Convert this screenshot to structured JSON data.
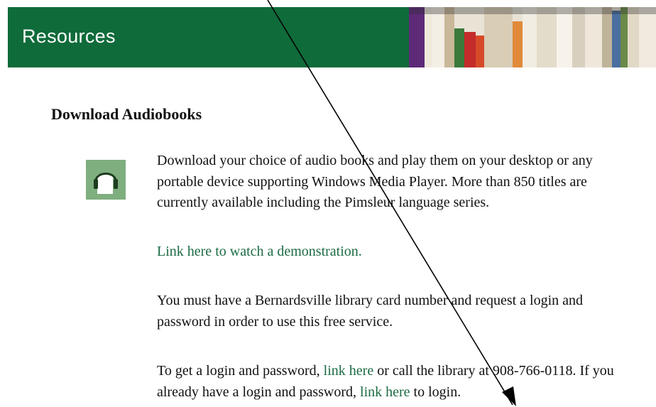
{
  "banner": {
    "title": "Resources"
  },
  "section": {
    "heading": "Download Audiobooks",
    "icon": "headphones-icon"
  },
  "paragraphs": {
    "p1": "Download your choice of audio books and play them on your desktop or any portable device supporting Windows Media Player. More than 850 titles are currently available including the Pimsleur language series.",
    "demo_link": "Link here to watch a demonstration.",
    "p3": "You must have a Bernardsville library card number and request a login and password in order to use this free service.",
    "p4_part1": "To get a login and password, ",
    "p4_link1": "link here",
    "p4_part2": " or call the library at 908-766-0118. If you already have a login and password, ",
    "p4_link2": "link here",
    "p4_part3": " to login."
  },
  "colors": {
    "banner": "#0f6b3a",
    "link": "#1b6b43",
    "icon_bg": "#7fae7f"
  }
}
